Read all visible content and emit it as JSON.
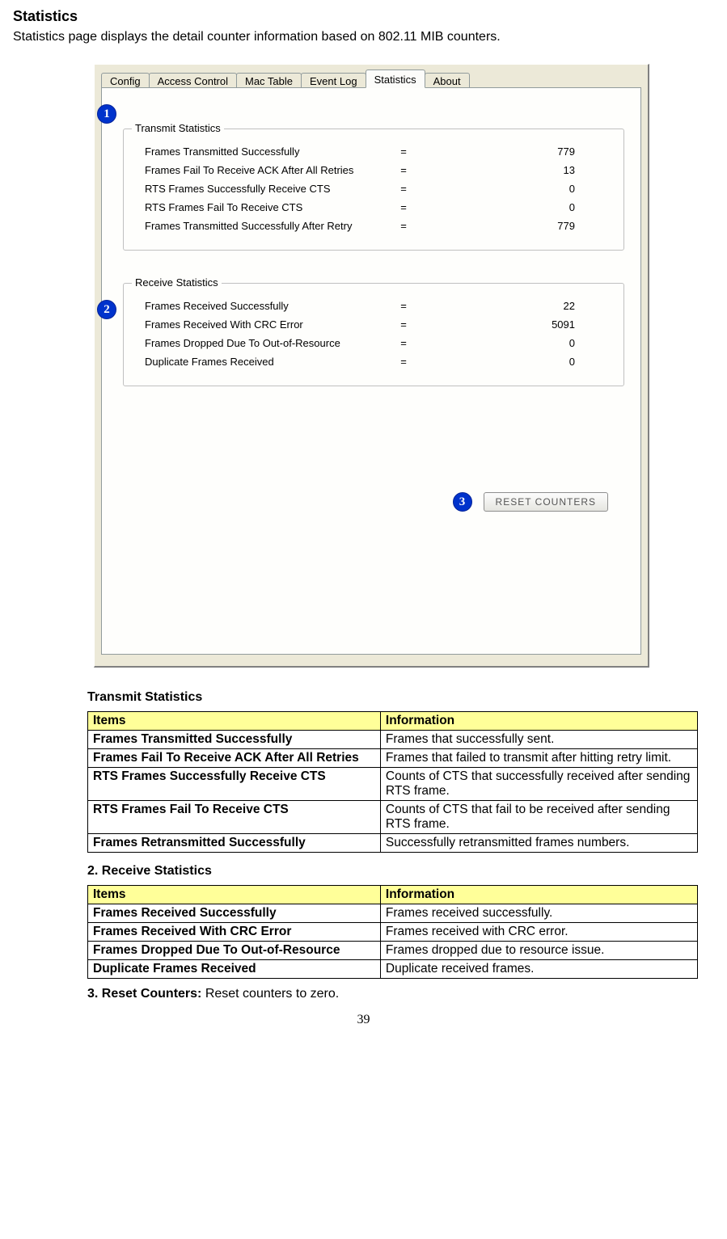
{
  "page": {
    "title": "Statistics",
    "description": "Statistics page displays the detail counter information based on 802.11 MIB counters.",
    "number": "39"
  },
  "tabs": {
    "t0": "Config",
    "t1": "Access Control",
    "t2": "Mac Table",
    "t3": "Event Log",
    "t4": "Statistics",
    "t5": "About"
  },
  "callouts": {
    "c1": "1",
    "c2": "2",
    "c3": "3"
  },
  "tx": {
    "legend": "Transmit Statistics",
    "rows": {
      "r0": {
        "label": "Frames Transmitted Successfully",
        "eq": "=",
        "val": "779"
      },
      "r1": {
        "label": "Frames Fail To Receive ACK After All Retries",
        "eq": "=",
        "val": "13"
      },
      "r2": {
        "label": "RTS Frames Successfully Receive CTS",
        "eq": "=",
        "val": "0"
      },
      "r3": {
        "label": "RTS Frames Fail To Receive CTS",
        "eq": "=",
        "val": "0"
      },
      "r4": {
        "label": "Frames Transmitted Successfully After Retry",
        "eq": "=",
        "val": "779"
      }
    }
  },
  "rx": {
    "legend": "Receive Statistics",
    "rows": {
      "r0": {
        "label": "Frames Received Successfully",
        "eq": "=",
        "val": "22"
      },
      "r1": {
        "label": "Frames Received With CRC Error",
        "eq": "=",
        "val": "5091"
      },
      "r2": {
        "label": "Frames Dropped Due To Out-of-Resource",
        "eq": "=",
        "val": "0"
      },
      "r3": {
        "label": "Duplicate Frames Received",
        "eq": "=",
        "val": "0"
      }
    }
  },
  "reset_button": "RESET COUNTERS",
  "tx_section": {
    "heading": "Transmit Statistics",
    "hdr_items": "Items",
    "hdr_info": "Information",
    "rows": {
      "r0": {
        "item": "Frames Transmitted Successfully",
        "info": "Frames that successfully sent."
      },
      "r1": {
        "item": "Frames Fail To Receive ACK After All Retries",
        "info": "Frames that failed to transmit after hitting retry limit."
      },
      "r2": {
        "item": "RTS Frames Successfully Receive CTS",
        "info": "Counts of CTS that successfully received after sending RTS frame."
      },
      "r3": {
        "item": "RTS Frames Fail To Receive CTS",
        "info": "Counts of CTS that fail to be received after sending RTS frame."
      },
      "r4": {
        "item": "Frames Retransmitted Successfully",
        "info": "Successfully retransmitted frames numbers."
      }
    }
  },
  "rx_section": {
    "heading": "2. Receive Statistics",
    "hdr_items": "Items",
    "hdr_info": "Information",
    "rows": {
      "r0": {
        "item": "Frames Received Successfully",
        "info": "Frames received successfully."
      },
      "r1": {
        "item": "Frames Received With CRC Error",
        "info": "Frames received with CRC error."
      },
      "r2": {
        "item": "Frames Dropped Due To Out-of-Resource",
        "info": "Frames dropped due to resource issue."
      },
      "r3": {
        "item": "Duplicate Frames Received",
        "info": "Duplicate received frames."
      }
    }
  },
  "reset_section": {
    "prefix": "3. Reset Counters: ",
    "text": "Reset counters to zero."
  }
}
